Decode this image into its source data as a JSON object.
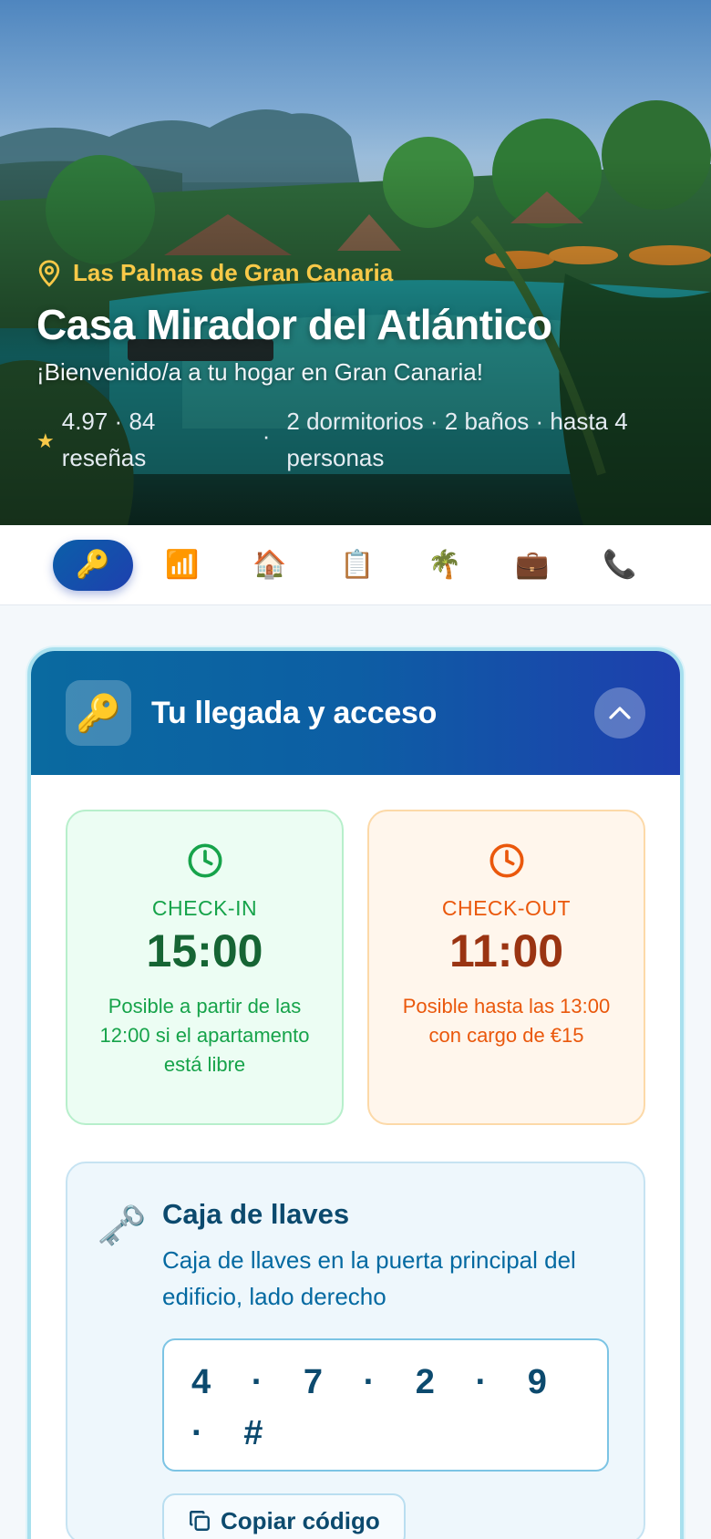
{
  "hero": {
    "location": "Las Palmas de Gran Canaria",
    "title": "Casa Mirador del Atlántico",
    "subtitle": "¡Bienvenido/a a tu hogar en Gran Canaria!",
    "rating": "4.97 · 84 reseñas",
    "separator": "·",
    "details": "2 dormitorios · 2 baños · hasta 4 personas"
  },
  "tabs": [
    {
      "icon": "key",
      "glyph": "🔑",
      "active": true
    },
    {
      "icon": "wifi-signal",
      "glyph": "📶",
      "active": false
    },
    {
      "icon": "house",
      "glyph": "🏠",
      "active": false
    },
    {
      "icon": "clipboard",
      "glyph": "📋",
      "active": false
    },
    {
      "icon": "palm-tree",
      "glyph": "🌴",
      "active": false
    },
    {
      "icon": "luggage",
      "glyph": "💼",
      "active": false
    },
    {
      "icon": "phone",
      "glyph": "📞",
      "active": false
    }
  ],
  "section": {
    "icon": "🔑",
    "title": "Tu llegada y acceso",
    "checkin": {
      "label": "CHECK-IN",
      "time": "15:00",
      "note": "Posible a partir de las 12:00 si el apartamento está libre"
    },
    "checkout": {
      "label": "CHECK-OUT",
      "time": "11:00",
      "note": "Posible hasta las 13:00 con cargo de €15"
    },
    "keybox": {
      "icon": "🗝️",
      "title": "Caja de llaves",
      "description": "Caja de llaves en la puerta principal del edificio, lado derecho",
      "code": "4 · 7 · 2 · 9 · #",
      "copy_label": "Copiar código"
    }
  },
  "colors": {
    "accent": "#1e40af",
    "location": "#f8c948",
    "checkin": "#16a34a",
    "checkout": "#ea580c"
  }
}
